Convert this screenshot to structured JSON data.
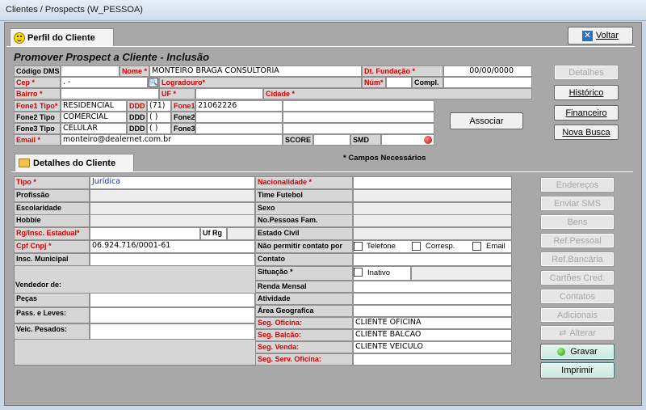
{
  "window": {
    "title": "Clientes / Prospects (W_PESSOA)"
  },
  "tabs": {
    "perfil": "Perfil do Cliente",
    "detalhes": "Detalhes do Cliente"
  },
  "voltar_label": "Voltar",
  "section_title": "Promover Prospect a Cliente - Inclusão",
  "top_form": {
    "codigo_dms": "Código DMS",
    "nome_label": "Nome *",
    "nome": "MONTEIRO BRAGA CONSULTORIA",
    "dt_fundacao_label": "Dt. Fundação *",
    "dt_fundacao": "00/00/0000",
    "cep_label": "Cep *",
    "cep": " .   -",
    "logradouro_label": "Logradouro*",
    "num_label": "Núm*",
    "compl_label": "Compl.",
    "bairro_label": "Bairro *",
    "uf_label": "UF *",
    "cidade_label": "Cidade *",
    "fone1_tipo_label": "Fone1 Tipo*",
    "fone1_tipo": "RESIDENCIAL",
    "ddd_label": "DDD",
    "fone1_ddd": "(71)",
    "fone1_label": "Fone1",
    "fone1": "21062226",
    "fone2_tipo_label": "Fone2 Tipo",
    "fone2_tipo": "COMERCIAL",
    "fone2_ddd": "(  )",
    "fone2_label": "Fone2",
    "fone3_tipo_label": "Fone3 Tipo",
    "fone3_tipo": "CELULAR",
    "fone3_ddd": "(  )",
    "fone3_label": "Fone3",
    "email_label": "Email *",
    "email": "monteiro@dealernet.com.br",
    "score_label": "SCORE",
    "smd_label": "SMD"
  },
  "side_buttons": {
    "detalhes": "Detalhes",
    "historico": "Histórico",
    "financeiro": "Financeiro",
    "nova_busca": "Nova Busca"
  },
  "associar_label": "Associar",
  "required_note": "* Campos Necessários",
  "details_left": {
    "tipo_label": "Tipo *",
    "tipo": "Jurídica",
    "profissao": "Profissão",
    "escolaridade": "Escolaridade",
    "hobbie": "Hobbie",
    "rg_label": "Rg/Insc. Estadual*",
    "uf_rg": "Uf Rg",
    "cpf_label": "Cpf Cnpj *",
    "cpf": "06.924.716/0001-61",
    "insc_municipal": "Insc. Municipal",
    "vendedor": "Vendedor de:",
    "pecas": "Peças",
    "pass_leves": "Pass. e Leves:",
    "veic_pesados": "Veic. Pesados:"
  },
  "details_right": {
    "nacionalidade_label": "Nacionalidade *",
    "time_futebol": "Time Futebol",
    "sexo": "Sexo",
    "no_pessoas": "No.Pessoas Fam.",
    "estado_civil": "Estado Civil",
    "nao_permitir": "Não permitir contato por",
    "telefone": "Telefone",
    "corresp": "Corresp.",
    "email": "Email",
    "contato": "Contato",
    "situacao_label": "Situação *",
    "inativo": "Inativo",
    "renda": "Renda Mensal",
    "atividade": "Atividade",
    "area": "Área Geografica",
    "seg_oficina_label": "Seg. Oficina:",
    "seg_oficina": "CLIENTE OFICINA",
    "seg_balcao_label": "Seg. Balcão:",
    "seg_balcao": "CLIENTE BALCÃO",
    "seg_venda_label": "Seg. Venda:",
    "seg_venda": "CLIENTE VEICULO",
    "seg_serv_label": "Seg. Serv. Oficina:"
  },
  "right_buttons": {
    "enderecos": "Endereços",
    "enviar_sms": "Enviar SMS",
    "bens": "Bens",
    "ref_pessoal": "Ref.Pessoal",
    "ref_bancaria": "Ref.Bancária",
    "cartoes": "Cartões Cred.",
    "contatos": "Contatos",
    "adicionais": "Adicionais",
    "alterar": "Alterar",
    "gravar": "Gravar",
    "imprimir": "Imprimir"
  }
}
